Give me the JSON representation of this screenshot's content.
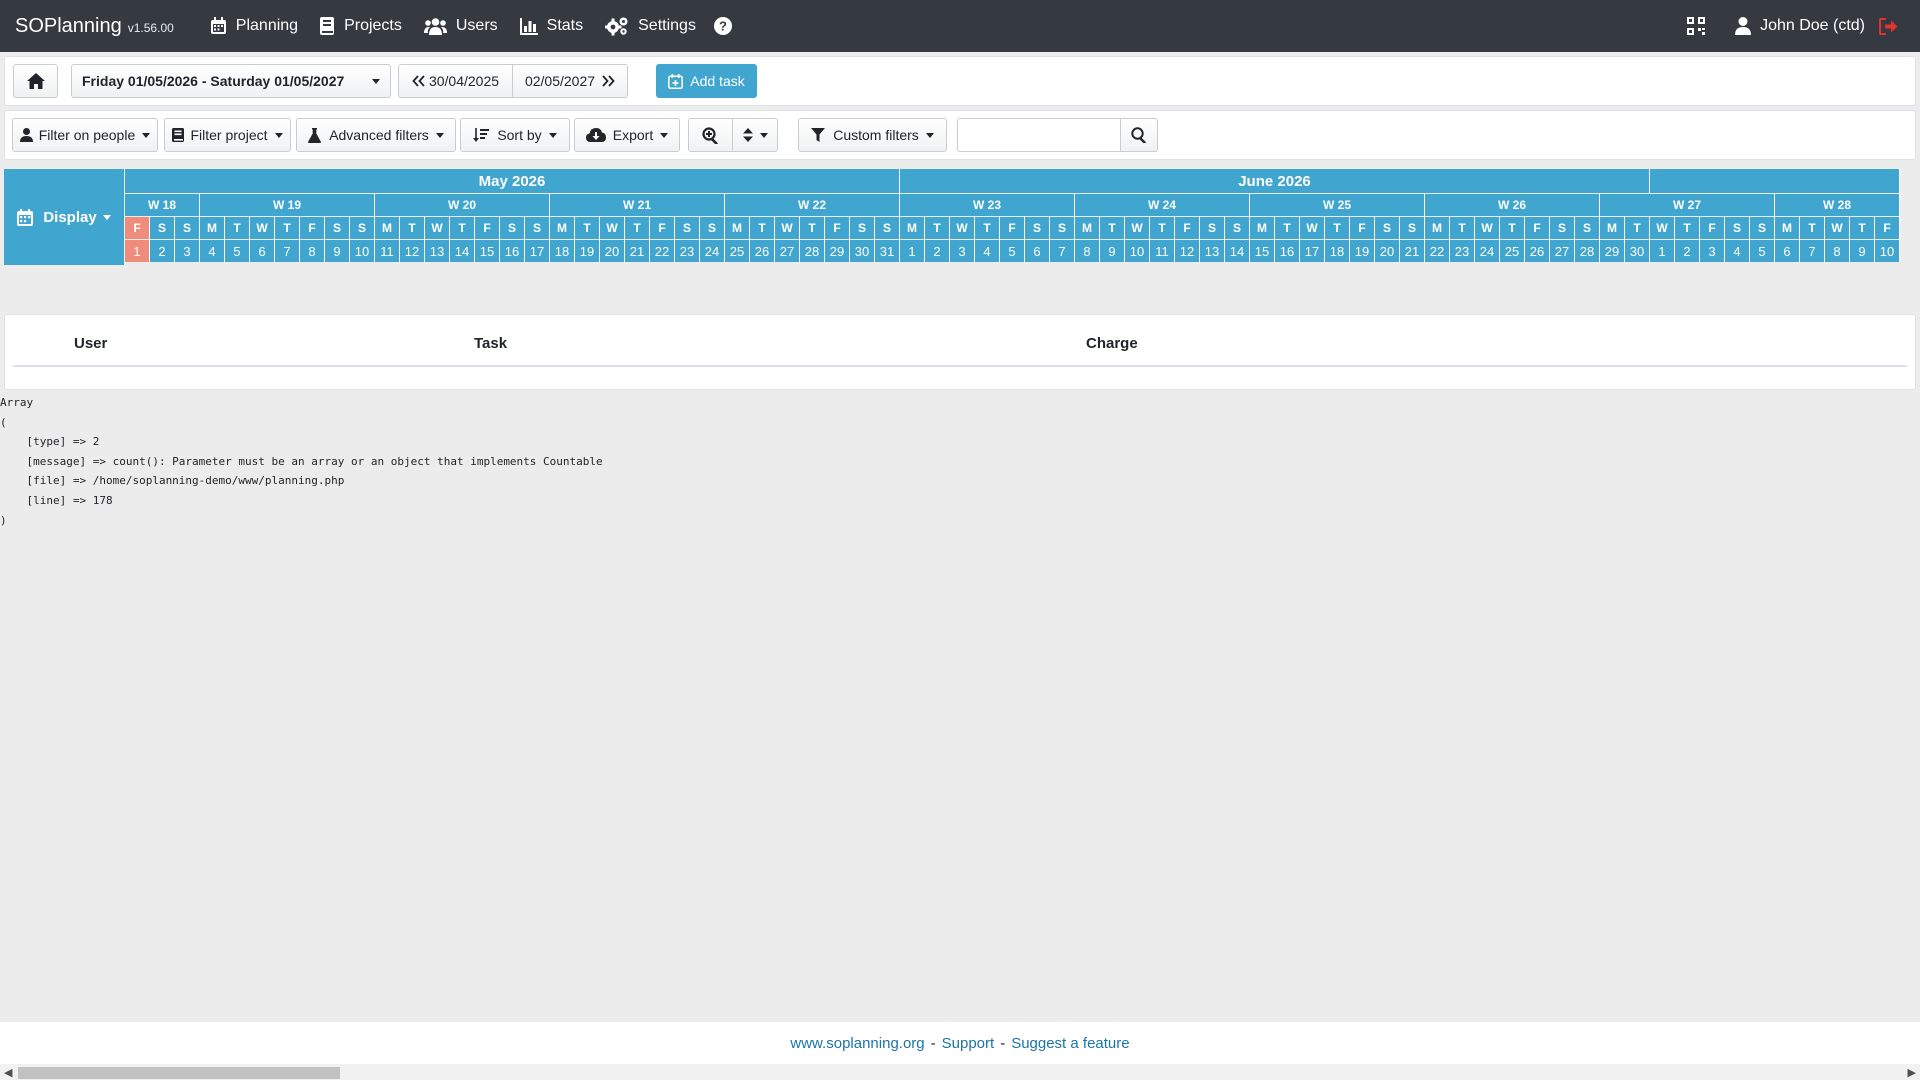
{
  "navbar": {
    "brand": "SOPlanning",
    "version": "v1.56.00",
    "items": [
      {
        "label": "Planning",
        "icon": "calendar-icon"
      },
      {
        "label": "Projects",
        "icon": "book-icon"
      },
      {
        "label": "Users",
        "icon": "users-icon"
      },
      {
        "label": "Stats",
        "icon": "chart-icon"
      },
      {
        "label": "Settings",
        "icon": "gears-icon"
      }
    ],
    "help_icon": "help-icon",
    "qr_icon": "qrcode-icon",
    "user_name": "John Doe (ctd)",
    "logout_icon": "logout-icon",
    "logout_color": "#e03131"
  },
  "toolbar": {
    "date_range": "Friday 01/05/2026 - Saturday 01/05/2027",
    "prev_date": "30/04/2025",
    "next_date": "02/05/2027",
    "add_task": "Add task"
  },
  "filters": {
    "people": "Filter on people",
    "project": "Filter project",
    "advanced": "Advanced filters",
    "sort": "Sort by",
    "export": "Export",
    "custom": "Custom filters",
    "search_value": ""
  },
  "planning": {
    "display_label": "Display",
    "months": [
      {
        "label": "May 2026",
        "days": 31
      },
      {
        "label": "June 2026",
        "days": 30
      },
      {
        "label": "",
        "days": 10
      }
    ],
    "weeks": [
      {
        "label": "W 18",
        "days": 3
      },
      {
        "label": "W 19",
        "days": 7
      },
      {
        "label": "W 20",
        "days": 7
      },
      {
        "label": "W 21",
        "days": 7
      },
      {
        "label": "W 22",
        "days": 7
      },
      {
        "label": "W 23",
        "days": 7
      },
      {
        "label": "W 24",
        "days": 7
      },
      {
        "label": "W 25",
        "days": 7
      },
      {
        "label": "W 26",
        "days": 7
      },
      {
        "label": "W 27",
        "days": 7
      },
      {
        "label": "W 28",
        "days": 5
      }
    ],
    "weekdays": [
      "F",
      "S",
      "S",
      "M",
      "T",
      "W",
      "T",
      "F",
      "S",
      "S",
      "M",
      "T",
      "W",
      "T",
      "F",
      "S",
      "S",
      "M",
      "T",
      "W",
      "T",
      "F",
      "S",
      "S",
      "M",
      "T",
      "W",
      "T",
      "F",
      "S",
      "S",
      "M",
      "T",
      "W",
      "T",
      "F",
      "S",
      "S",
      "M",
      "T",
      "W",
      "T",
      "F",
      "S",
      "S",
      "M",
      "T",
      "W",
      "T",
      "F",
      "S",
      "S",
      "M",
      "T",
      "W",
      "T",
      "F",
      "S",
      "S",
      "M",
      "T",
      "W",
      "T",
      "F",
      "S",
      "S",
      "M",
      "T",
      "W",
      "T",
      "F"
    ],
    "days": [
      "1",
      "2",
      "3",
      "4",
      "5",
      "6",
      "7",
      "8",
      "9",
      "10",
      "11",
      "12",
      "13",
      "14",
      "15",
      "16",
      "17",
      "18",
      "19",
      "20",
      "21",
      "22",
      "23",
      "24",
      "25",
      "26",
      "27",
      "28",
      "29",
      "30",
      "31",
      "1",
      "2",
      "3",
      "4",
      "5",
      "6",
      "7",
      "8",
      "9",
      "10",
      "11",
      "12",
      "13",
      "14",
      "15",
      "16",
      "17",
      "18",
      "19",
      "20",
      "21",
      "22",
      "23",
      "24",
      "25",
      "26",
      "27",
      "28",
      "29",
      "30",
      "1",
      "2",
      "3",
      "4",
      "5",
      "6",
      "7",
      "8",
      "9",
      "10"
    ],
    "today_index": 0,
    "header_color": "#41a6cf",
    "today_color": "#f08c7c"
  },
  "table": {
    "columns": [
      "User",
      "Task",
      "Charge"
    ]
  },
  "debug_output": "Array\n(\n    [type] => 2\n    [message] => count(): Parameter must be an array or an object that implements Countable\n    [file] => /home/soplanning-demo/www/planning.php\n    [line] => 178\n)",
  "footer": {
    "site": "www.soplanning.org",
    "support": "Support",
    "suggest": "Suggest a feature",
    "separator": "-"
  }
}
